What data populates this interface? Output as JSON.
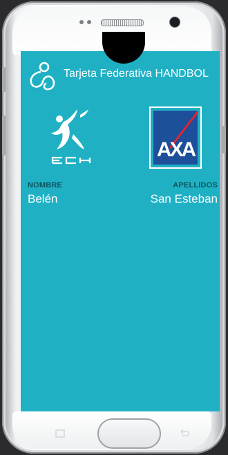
{
  "app": {
    "title": "Tarjeta Federativa HANDBOL"
  },
  "logos": {
    "fch_text": "FCH",
    "axa_text": "AXA"
  },
  "card": {
    "nombre_label": "NOMBRE",
    "nombre_value": "Belén",
    "apellidos_label": "APELLIDOS",
    "apellidos_value": "San Esteban"
  },
  "colors": {
    "screen_bg": "#1fb0c4",
    "label_text": "#0d5560",
    "value_text": "#ffffff",
    "axa_blue": "#1f4fa0",
    "axa_red": "#e0262f"
  }
}
